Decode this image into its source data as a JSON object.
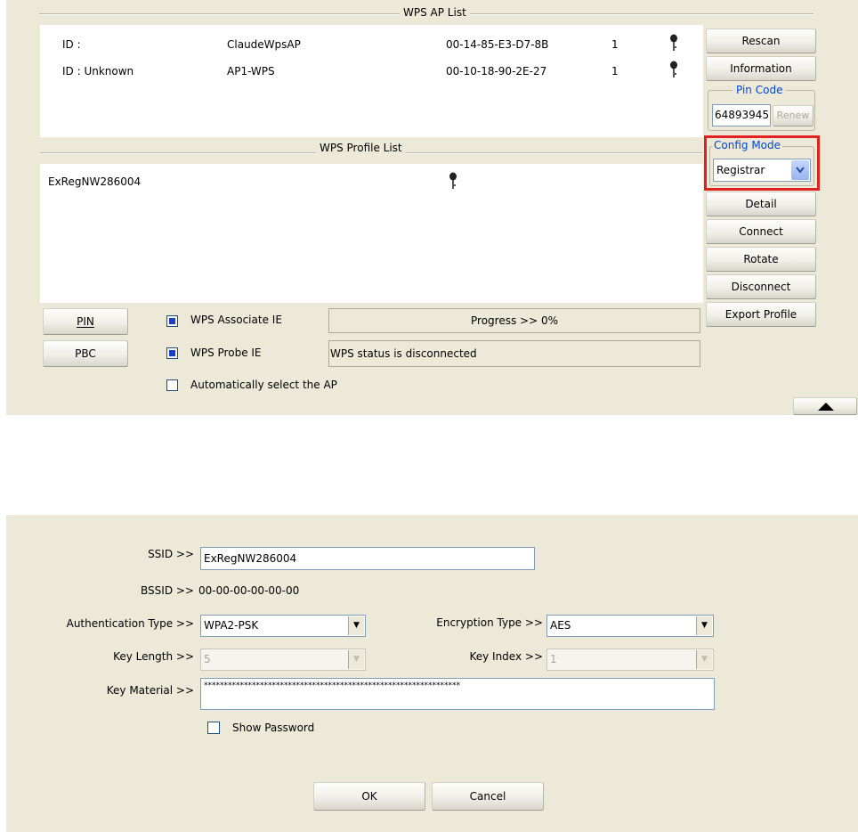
{
  "wps_panel": {
    "ap_list_title": "WPS AP List",
    "ap_list": [
      {
        "id": "ID :",
        "name": "ClaudeWpsAP",
        "bssid": "00-14-85-E3-D7-8B",
        "channel": "1"
      },
      {
        "id": "ID : Unknown",
        "name": "AP1-WPS",
        "bssid": "00-10-18-90-2E-27",
        "channel": "1"
      }
    ],
    "profile_list_title": "WPS Profile List",
    "profiles": [
      {
        "name": "ExRegNW286004"
      }
    ],
    "buttons": {
      "rescan": "Rescan",
      "information": "Information",
      "detail": "Detail",
      "connect": "Connect",
      "rotate": "Rotate",
      "disconnect": "Disconnect",
      "export_profile": "Export Profile",
      "pin": "PIN",
      "pbc": "PBC",
      "renew": "Renew"
    },
    "pin_code": {
      "label": "Pin Code",
      "value": "64893945"
    },
    "config_mode": {
      "label": "Config Mode",
      "value": "Registrar"
    },
    "checkboxes": {
      "associate_ie": {
        "label": "WPS Associate IE",
        "checked": true
      },
      "probe_ie": {
        "label": "WPS Probe IE",
        "checked": true
      },
      "auto_select": {
        "label": "Automatically select the AP",
        "checked": false
      }
    },
    "progress_text": "Progress >> 0%",
    "progress_value": 0,
    "status_text": "WPS status is disconnected",
    "highlight_color": "#e0211f"
  },
  "profile_dialog": {
    "ssid_label": "SSID >>",
    "ssid_value": "ExRegNW286004",
    "bssid_label": "BSSID >>",
    "bssid_value": "00-00-00-00-00-00",
    "auth_label": "Authentication Type >>",
    "auth_value": "WPA2-PSK",
    "enc_label": "Encryption Type >>",
    "enc_value": "AES",
    "keylen_label": "Key Length >>",
    "keylen_value": "5",
    "keyidx_label": "Key Index >>",
    "keyidx_value": "1",
    "keymat_label": "Key Material >>",
    "keymat_value": "****************************************************************",
    "show_password_label": "Show Password",
    "ok_label": "OK",
    "cancel_label": "Cancel"
  }
}
